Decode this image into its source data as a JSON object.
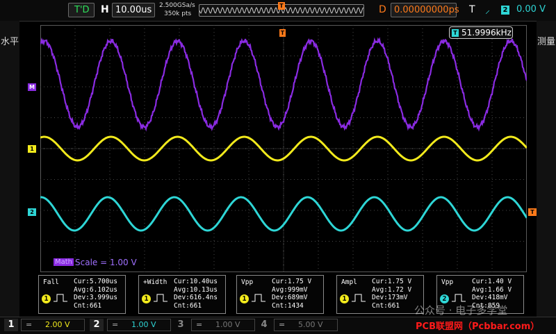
{
  "top": {
    "trig_mode": "T'D",
    "h_label": "H",
    "timebase": "10.00us",
    "sample_rate": "2.500GSa/s",
    "mem_depth": "350k pts",
    "t_marker": "T",
    "d_label": "D",
    "delay": "0.00000000ps",
    "trig_label": "T",
    "trig_source": "2",
    "trig_level": "0.00 V"
  },
  "side_left": "水平",
  "side_right": "测量",
  "freq_readout": "51.9996kHz",
  "freq_badge": "T",
  "markers": {
    "math": "M",
    "ch1": "1",
    "ch2": "2",
    "trig": "T"
  },
  "math_scale": {
    "badge": "Math",
    "text": "Scale = 1.00 V"
  },
  "measurements": [
    {
      "name": "Fall",
      "cur": "Cur:5.700us",
      "avg": "Avg:6.102us",
      "dev": "Dev:3.999us",
      "cnt": "Cnt:661",
      "src": "1"
    },
    {
      "name": "+Width",
      "cur": "Cur:10.40us",
      "avg": "Avg:10.13us",
      "dev": "Dev:616.4ns",
      "cnt": "Cnt:661",
      "src": "1"
    },
    {
      "name": "Vpp",
      "cur": "Cur:1.75 V",
      "avg": "Avg:999mV",
      "dev": "Dev:689mV",
      "cnt": "Cnt:1434",
      "src": "1"
    },
    {
      "name": "Ampl",
      "cur": "Cur:1.75 V",
      "avg": "Avg:1.72 V",
      "dev": "Dev:173mV",
      "cnt": "Cnt:661",
      "src": "1"
    },
    {
      "name": "Vpp",
      "cur": "Cur:1.40 V",
      "avg": "Avg:1.66 V",
      "dev": "Dev:418mV",
      "cnt": "Cnt:859",
      "src": "2"
    }
  ],
  "channels": [
    {
      "num": "1",
      "coupling": "=",
      "scale": "2.00 V"
    },
    {
      "num": "2",
      "coupling": "=",
      "scale": "1.00 V"
    },
    {
      "num": "3",
      "coupling": "=",
      "scale": "1.00 V"
    },
    {
      "num": "4",
      "coupling": "=",
      "scale": "5.00 V"
    }
  ],
  "watermark": {
    "wechat": "公众号 · 电子多学堂",
    "site": "PCB联盟网（Pcbbar.com）"
  },
  "colors": {
    "ch1": "#f2ea1c",
    "ch2": "#2ed6d6",
    "math": "#8a2be2",
    "trig": "#ff7a1a"
  }
}
